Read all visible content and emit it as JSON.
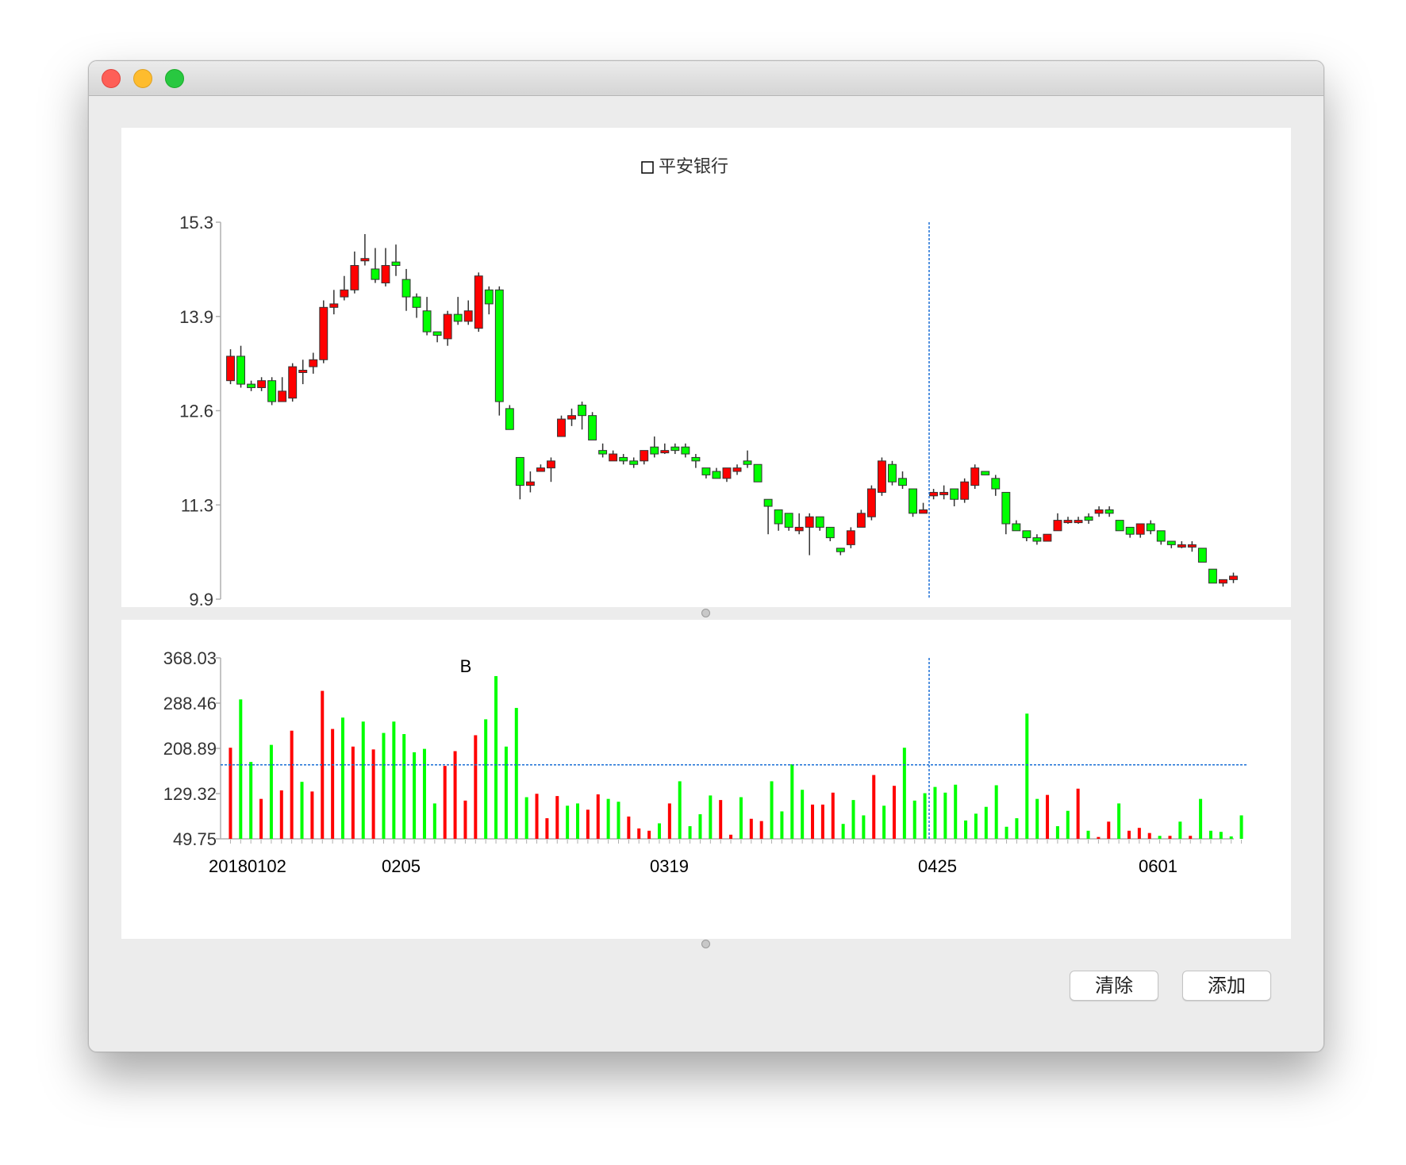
{
  "colors": {
    "up": "#ff0000",
    "down": "#00ff00",
    "crosshair": "#1a6fd6",
    "axis": "#b0b0b0",
    "text": "#333333"
  },
  "buttons": {
    "clear": "清除",
    "add": "添加"
  },
  "chart_data": [
    {
      "type": "candlestick",
      "title": "平安银行",
      "legend": "top-center",
      "y_ticks": [
        "15.3",
        "13.9",
        "12.6",
        "11.3",
        "9.9"
      ],
      "ylim": [
        9.9,
        15.3
      ],
      "crosshair_index": 126,
      "candles": [
        [
          13.03,
          13.38,
          13.48,
          12.98
        ],
        [
          13.38,
          12.98,
          13.53,
          12.93
        ],
        [
          12.98,
          12.93,
          13.03,
          12.88
        ],
        [
          12.93,
          13.03,
          13.08,
          12.88
        ],
        [
          13.03,
          12.73,
          13.08,
          12.68
        ],
        [
          12.73,
          12.88,
          13.08,
          12.73
        ],
        [
          12.78,
          13.23,
          13.28,
          12.73
        ],
        [
          13.18,
          13.18,
          13.33,
          12.98
        ],
        [
          13.23,
          13.33,
          13.43,
          13.13
        ],
        [
          13.33,
          14.08,
          14.18,
          13.28
        ],
        [
          14.08,
          14.13,
          14.33,
          13.98
        ],
        [
          14.23,
          14.33,
          14.53,
          14.18
        ],
        [
          14.33,
          14.68,
          14.88,
          14.28
        ],
        [
          14.78,
          14.78,
          15.13,
          14.68
        ],
        [
          14.63,
          14.48,
          14.93,
          14.43
        ],
        [
          14.43,
          14.68,
          14.93,
          14.38
        ],
        [
          14.73,
          14.68,
          14.98,
          14.53
        ],
        [
          14.48,
          14.23,
          14.63,
          14.03
        ],
        [
          14.23,
          14.08,
          14.28,
          13.93
        ],
        [
          14.03,
          13.73,
          14.23,
          13.68
        ],
        [
          13.73,
          13.68,
          13.73,
          13.58
        ],
        [
          13.63,
          13.98,
          14.03,
          13.53
        ],
        [
          13.98,
          13.88,
          14.23,
          13.83
        ],
        [
          13.88,
          14.03,
          14.18,
          13.83
        ],
        [
          13.78,
          14.53,
          14.58,
          13.73
        ],
        [
          14.33,
          14.13,
          14.38,
          13.98
        ],
        [
          14.33,
          12.73,
          14.38,
          12.53
        ],
        [
          12.63,
          12.33,
          12.68,
          12.33
        ],
        [
          11.93,
          11.53,
          11.93,
          11.33
        ],
        [
          11.53,
          11.58,
          11.73,
          11.43
        ],
        [
          11.73,
          11.78,
          11.83,
          11.73
        ],
        [
          11.78,
          11.88,
          11.93,
          11.58
        ],
        [
          12.23,
          12.48,
          12.53,
          12.23
        ],
        [
          12.48,
          12.53,
          12.63,
          12.38
        ],
        [
          12.68,
          12.53,
          12.73,
          12.33
        ],
        [
          12.53,
          12.18,
          12.58,
          12.18
        ],
        [
          12.03,
          11.98,
          12.13,
          11.93
        ],
        [
          11.88,
          11.98,
          12.03,
          11.93
        ],
        [
          11.93,
          11.88,
          11.98,
          11.83
        ],
        [
          11.88,
          11.83,
          11.93,
          11.78
        ],
        [
          11.88,
          12.03,
          12.03,
          11.83
        ],
        [
          12.08,
          11.98,
          12.23,
          11.93
        ],
        [
          12.03,
          12.03,
          12.13,
          11.98
        ],
        [
          12.08,
          12.03,
          12.13,
          11.98
        ],
        [
          12.08,
          11.98,
          12.13,
          11.93
        ],
        [
          11.93,
          11.88,
          11.98,
          11.78
        ],
        [
          11.78,
          11.68,
          11.78,
          11.63
        ],
        [
          11.73,
          11.63,
          11.78,
          11.63
        ],
        [
          11.63,
          11.78,
          11.78,
          11.58
        ],
        [
          11.73,
          11.78,
          11.83,
          11.68
        ],
        [
          11.88,
          11.83,
          12.03,
          11.78
        ],
        [
          11.83,
          11.58,
          11.83,
          11.58
        ],
        [
          11.33,
          11.23,
          11.33,
          10.83
        ],
        [
          11.18,
          10.98,
          11.18,
          10.88
        ],
        [
          11.13,
          10.93,
          11.13,
          10.88
        ],
        [
          10.88,
          10.93,
          11.13,
          10.83
        ],
        [
          10.93,
          11.08,
          11.13,
          10.53
        ],
        [
          11.08,
          10.93,
          11.08,
          10.88
        ],
        [
          10.93,
          10.78,
          10.93,
          10.73
        ],
        [
          10.63,
          10.58,
          10.63,
          10.53
        ],
        [
          10.68,
          10.88,
          10.93,
          10.63
        ],
        [
          10.93,
          11.13,
          11.18,
          10.93
        ],
        [
          11.08,
          11.48,
          11.53,
          11.03
        ],
        [
          11.43,
          11.88,
          11.93,
          11.38
        ],
        [
          11.83,
          11.58,
          11.88,
          11.53
        ],
        [
          11.63,
          11.53,
          11.73,
          11.48
        ],
        [
          11.48,
          11.13,
          11.48,
          11.08
        ],
        [
          11.13,
          11.18,
          11.28,
          11.13
        ],
        [
          11.38,
          11.43,
          11.48,
          11.33
        ],
        [
          11.43,
          11.43,
          11.53,
          11.33
        ],
        [
          11.48,
          11.33,
          11.48,
          11.23
        ],
        [
          11.33,
          11.58,
          11.63,
          11.28
        ],
        [
          11.53,
          11.78,
          11.83,
          11.48
        ],
        [
          11.73,
          11.68,
          11.73,
          11.68
        ],
        [
          11.63,
          11.48,
          11.68,
          11.38
        ],
        [
          11.43,
          10.98,
          11.43,
          10.83
        ],
        [
          10.98,
          10.88,
          11.03,
          10.88
        ],
        [
          10.88,
          10.78,
          10.88,
          10.73
        ],
        [
          10.78,
          10.73,
          10.83,
          10.68
        ],
        [
          10.73,
          10.83,
          10.83,
          10.73
        ],
        [
          10.88,
          11.03,
          11.13,
          10.88
        ],
        [
          11.03,
          11.03,
          11.08,
          10.98
        ],
        [
          11.03,
          11.03,
          11.08,
          10.98
        ],
        [
          11.08,
          11.03,
          11.13,
          10.98
        ],
        [
          11.13,
          11.18,
          11.23,
          11.08
        ],
        [
          11.18,
          11.13,
          11.23,
          11.08
        ],
        [
          11.03,
          10.88,
          11.03,
          10.88
        ],
        [
          10.93,
          10.83,
          10.93,
          10.78
        ],
        [
          10.83,
          10.98,
          10.98,
          10.78
        ],
        [
          10.98,
          10.88,
          11.03,
          10.83
        ],
        [
          10.88,
          10.73,
          10.88,
          10.68
        ],
        [
          10.73,
          10.68,
          10.73,
          10.63
        ],
        [
          10.68,
          10.68,
          10.73,
          10.63
        ],
        [
          10.68,
          10.68,
          10.73,
          10.58
        ],
        [
          10.63,
          10.43,
          10.63,
          10.43
        ],
        [
          10.33,
          10.13,
          10.33,
          10.13
        ],
        [
          10.13,
          10.18,
          10.18,
          10.08
        ],
        [
          10.18,
          10.23,
          10.28,
          10.13
        ]
      ]
    },
    {
      "type": "bar",
      "title": "",
      "y_ticks": [
        "368.03",
        "288.46",
        "208.89",
        "129.32",
        "49.75"
      ],
      "ylim": [
        49.75,
        368.03
      ],
      "x_labels": [
        {
          "label": "20180102",
          "index": 0
        },
        {
          "label": "0205",
          "index": 18
        },
        {
          "label": "0319",
          "index": 46
        },
        {
          "label": "0425",
          "index": 74
        },
        {
          "label": "0601",
          "index": 97
        }
      ],
      "marker": {
        "label": "B",
        "index": 26
      },
      "reference_line": 180,
      "crosshair_index": 126,
      "values": [
        210,
        295,
        185,
        120,
        215,
        135,
        240,
        150,
        133,
        310,
        243,
        263,
        212,
        256,
        207,
        236,
        256,
        234,
        202,
        208,
        112,
        178,
        204,
        117,
        232,
        260,
        336,
        212,
        280,
        123,
        129,
        86,
        125,
        108,
        112,
        101,
        128,
        120,
        115,
        89,
        68,
        64,
        77,
        112,
        151,
        72,
        93,
        126,
        118,
        57,
        123,
        85,
        81,
        151,
        98,
        181,
        136,
        110,
        110,
        131,
        76,
        118,
        91,
        162,
        108,
        143,
        210,
        117,
        130,
        141,
        131,
        145,
        82,
        94,
        106,
        144,
        71,
        86,
        270,
        120,
        127,
        72,
        99,
        138,
        64,
        53,
        80,
        112,
        64,
        69,
        60,
        55,
        55,
        80,
        55,
        120,
        64,
        62,
        54,
        91,
        117,
        100,
        59,
        53,
        53,
        53,
        53,
        53,
        53,
        53,
        53,
        53,
        53,
        53,
        53,
        53,
        53,
        53,
        53,
        53,
        53,
        53,
        53,
        53,
        53,
        53,
        53
      ],
      "up_flags": [
        1,
        0,
        0,
        1,
        0,
        1,
        1,
        0,
        1,
        1,
        1,
        0,
        1,
        0,
        1,
        0,
        0,
        0,
        0,
        0,
        0,
        1,
        1,
        1,
        1,
        0,
        0,
        0,
        0,
        0,
        1,
        1,
        1,
        0,
        0,
        1,
        1,
        0,
        0,
        1,
        1,
        1,
        0,
        1,
        0,
        0,
        0,
        0,
        1,
        1,
        0,
        1,
        1,
        0,
        0,
        0,
        0,
        1,
        1,
        1,
        0,
        0,
        0,
        1,
        0,
        1,
        0,
        0,
        0,
        0,
        0,
        0,
        0,
        0,
        0,
        0,
        0,
        0,
        0,
        0
      ]
    }
  ]
}
